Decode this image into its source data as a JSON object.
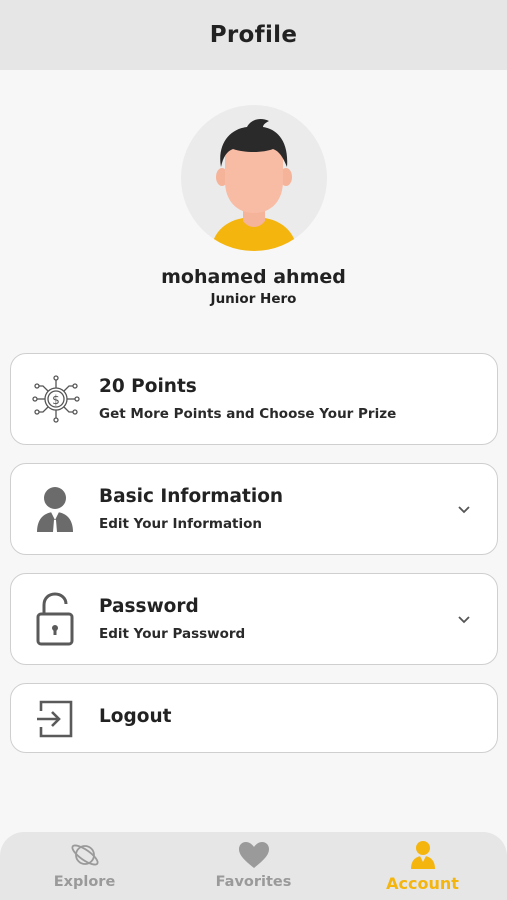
{
  "header": {
    "title": "Profile"
  },
  "user": {
    "name": "mohamed ahmed",
    "rank": "Junior Hero"
  },
  "cards": {
    "points": {
      "title": "20 Points",
      "subtitle": "Get More Points and Choose Your Prize",
      "icon": "coin-network-icon"
    },
    "basic": {
      "title": "Basic Information",
      "subtitle": "Edit Your Information",
      "icon": "user-icon"
    },
    "password": {
      "title": "Password",
      "subtitle": "Edit Your Password",
      "icon": "lock-icon"
    },
    "logout": {
      "title": "Logout",
      "icon": "logout-icon"
    }
  },
  "nav": {
    "items": [
      {
        "label": "Explore",
        "icon": "planet-icon",
        "active": false
      },
      {
        "label": "Favorites",
        "icon": "heart-icon",
        "active": false
      },
      {
        "label": "Account",
        "icon": "user-icon",
        "active": true
      }
    ]
  },
  "colors": {
    "accent": "#F5B50F",
    "inactive": "#9A9A9A",
    "header_bg": "#E6E6E6",
    "page_bg": "#F7F7F7"
  }
}
